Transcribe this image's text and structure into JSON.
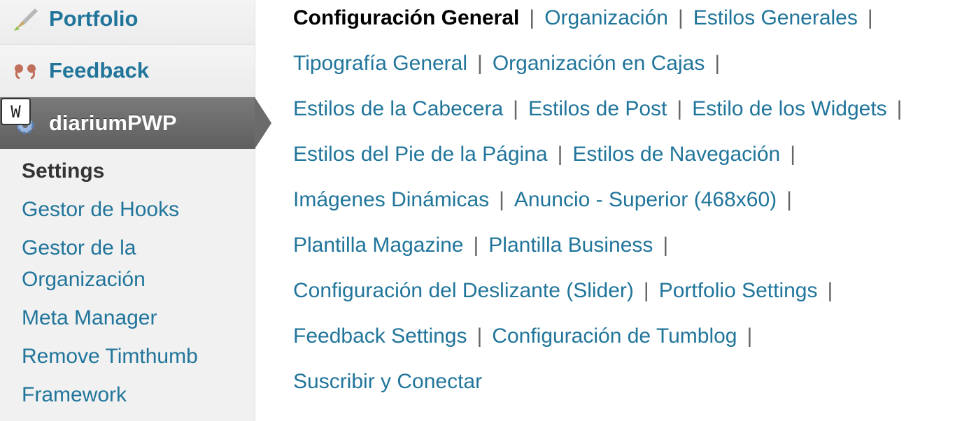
{
  "sidebar": {
    "menu": [
      {
        "label": "Portfolio",
        "icon": "brush-icon"
      },
      {
        "label": "Feedback",
        "icon": "quote-icon"
      },
      {
        "label": "diariumPWP",
        "icon": "gear-icon",
        "badge": "W"
      }
    ],
    "submenu": [
      "Settings",
      "Gestor de Hooks",
      "Gestor de la Organización",
      "Meta Manager",
      "Remove Timthumb",
      "Framework"
    ]
  },
  "tabs": [
    [
      "Configuración General",
      "Organización",
      "Estilos Generales"
    ],
    [
      "Tipografía General",
      "Organización en Cajas"
    ],
    [
      "Estilos de la Cabecera",
      "Estilos de Post",
      "Estilo de los Widgets"
    ],
    [
      "Estilos del Pie de la Página",
      "Estilos de Navegación"
    ],
    [
      "Imágenes Dinámicas",
      "Anuncio - Superior (468x60)"
    ],
    [
      "Plantilla Magazine",
      "Plantilla Business"
    ],
    [
      "Configuración del Deslizante (Slider)",
      "Portfolio Settings"
    ],
    [
      "Feedback Settings",
      "Configuración de Tumblog"
    ],
    [
      "Suscribir y Conectar"
    ]
  ],
  "separator": "|",
  "colors": {
    "link": "#21759b",
    "active": "#000000",
    "menu_active_bg": "#6b6b6b"
  }
}
